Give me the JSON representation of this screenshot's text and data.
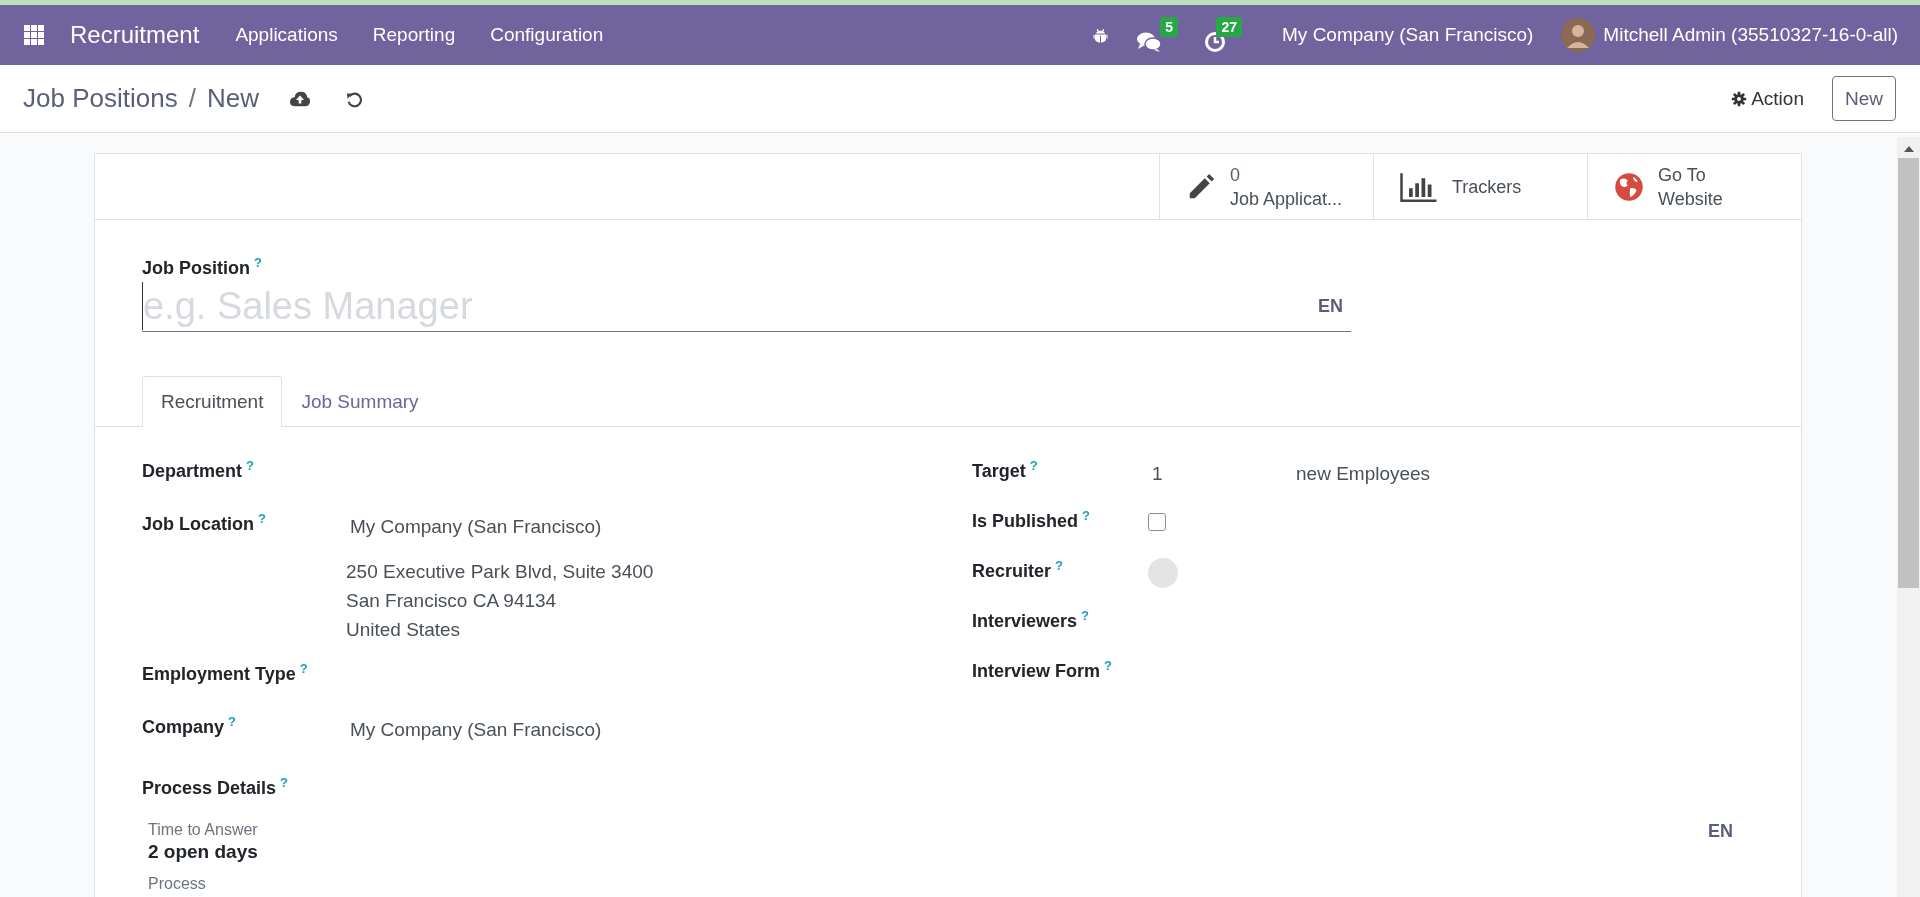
{
  "navbar": {
    "app_name": "Recruitment",
    "menus": [
      "Applications",
      "Reporting",
      "Configuration"
    ],
    "messages_count": "5",
    "activities_count": "27",
    "company": "My Company (San Francisco)",
    "user": "Mitchell Admin (35510327-16-0-all)"
  },
  "control_panel": {
    "breadcrumb": "Job Positions",
    "separator": "/",
    "current": "New",
    "action": "Action",
    "new_button": "New"
  },
  "smart_buttons": [
    {
      "kind": "applications",
      "value": "0",
      "label": "Job Applicat..."
    },
    {
      "kind": "trackers",
      "label": "Trackers"
    },
    {
      "kind": "website",
      "label": "Go To Website"
    }
  ],
  "job_position": {
    "label": "Job Position",
    "help": "?",
    "placeholder": "e.g. Sales Manager",
    "lang": "EN"
  },
  "tabs": [
    {
      "label": "Recruitment",
      "selected": true
    },
    {
      "label": "Job Summary",
      "selected": false
    }
  ],
  "left_fields": [
    {
      "kind": "text",
      "label": "Department",
      "help": "?"
    },
    {
      "kind": "address",
      "label": "Job Location",
      "help": "?",
      "value": "My Company (San Francisco)",
      "lines": [
        "250 Executive Park Blvd, Suite 3400",
        "San Francisco CA 94134",
        "United States"
      ]
    },
    {
      "kind": "text",
      "label": "Employment Type",
      "help": "?"
    },
    {
      "kind": "text",
      "label": "Company",
      "help": "?",
      "value": "My Company (San Francisco)"
    }
  ],
  "right_fields": [
    {
      "kind": "target",
      "label": "Target",
      "help": "?",
      "value": "1",
      "unit": "new Employees"
    },
    {
      "kind": "checkbox",
      "label": "Is Published",
      "help": "?",
      "checked": false
    },
    {
      "kind": "avatar",
      "label": "Recruiter",
      "help": "?"
    },
    {
      "kind": "text",
      "label": "Interviewers",
      "help": "?"
    },
    {
      "kind": "text",
      "label": "Interview Form",
      "help": "?"
    }
  ],
  "process_details": {
    "label": "Process Details",
    "help": "?",
    "lang": "EN",
    "fields": [
      {
        "label": "Time to Answer",
        "value": "2 open days"
      },
      {
        "label": "Process"
      }
    ]
  }
}
